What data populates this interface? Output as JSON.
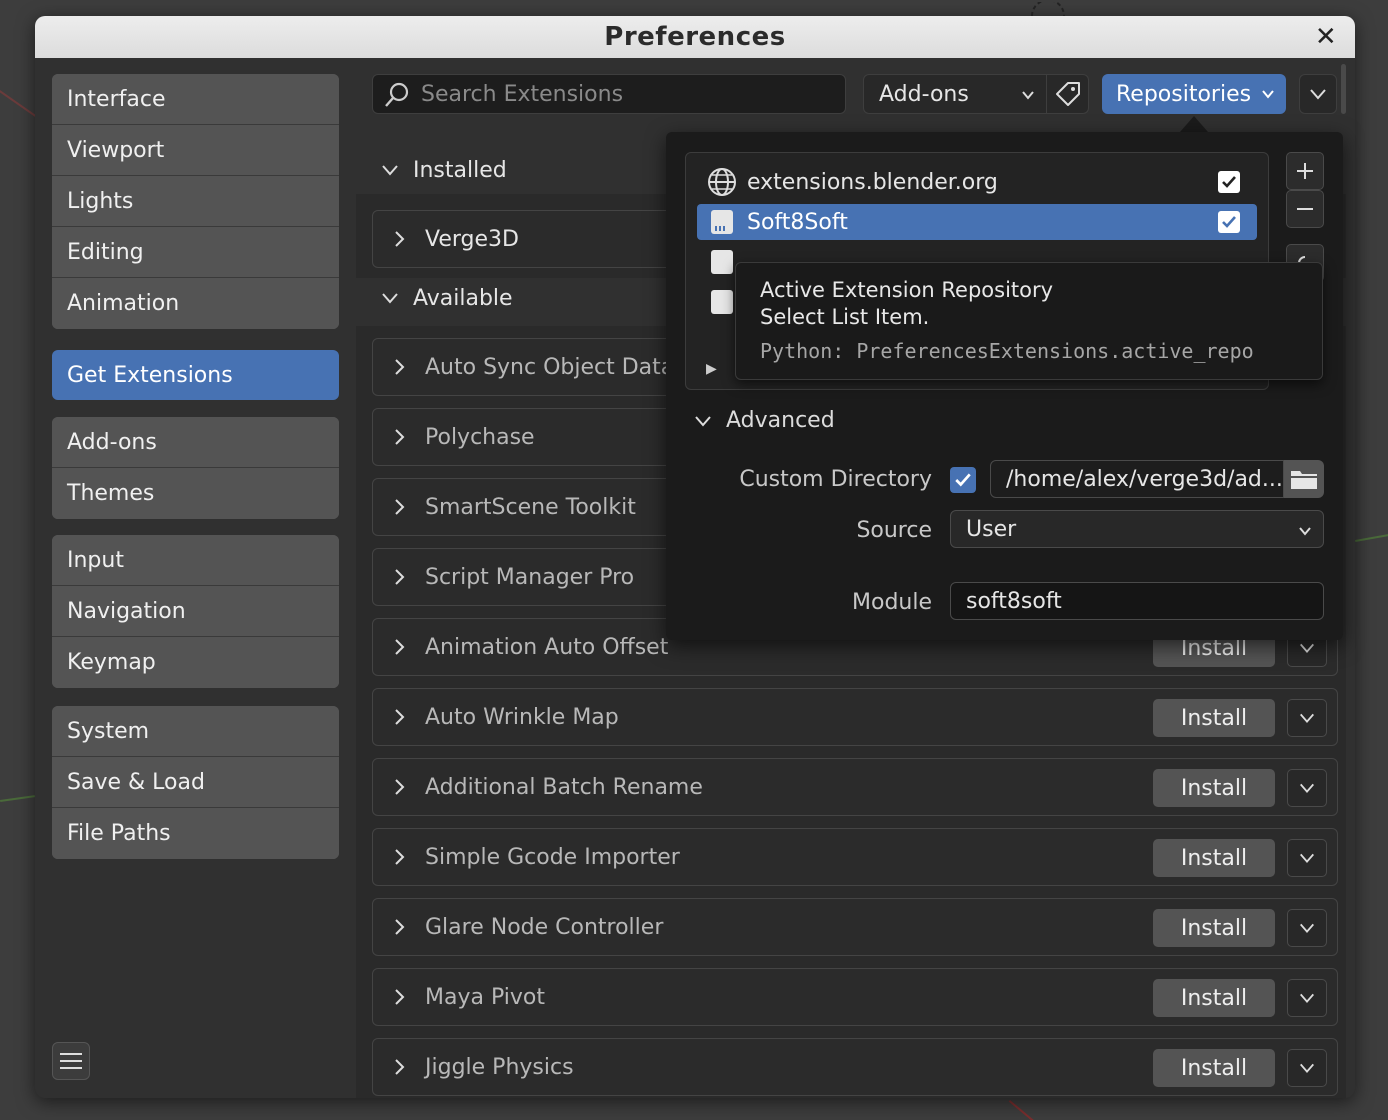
{
  "window": {
    "title": "Preferences"
  },
  "sidebar": {
    "groups": [
      [
        "Interface",
        "Viewport",
        "Lights",
        "Editing",
        "Animation"
      ],
      [
        "Get Extensions"
      ],
      [
        "Add-ons",
        "Themes"
      ],
      [
        "Input",
        "Navigation",
        "Keymap"
      ],
      [
        "System",
        "Save & Load",
        "File Paths"
      ]
    ],
    "active": "Get Extensions"
  },
  "toolbar": {
    "search_placeholder": "Search Extensions",
    "filter_selected": "Add-ons",
    "repositories_label": "Repositories"
  },
  "sections": {
    "installed": "Installed",
    "available": "Available"
  },
  "installed_items": [
    "Verge3D"
  ],
  "available_items": [
    "Auto Sync Object Data N",
    "Polychase",
    "SmartScene Toolkit",
    "Script Manager Pro",
    "Animation Auto Offset",
    "Auto Wrinkle Map",
    "Additional Batch Rename",
    "Simple Gcode Importer",
    "Glare Node Controller",
    "Maya Pivot",
    "Jiggle Physics"
  ],
  "install_label": "Install",
  "repositories": {
    "items": [
      {
        "name": "extensions.blender.org",
        "enabled": true
      },
      {
        "name": "Soft8Soft",
        "enabled": true,
        "selected": true
      }
    ],
    "advanced_label": "Advanced",
    "custom_directory_label": "Custom Directory",
    "custom_directory_checked": true,
    "custom_directory_value": "/home/alex/verge3d/ad...",
    "source_label": "Source",
    "source_value": "User",
    "module_label": "Module",
    "module_value": "soft8soft"
  },
  "tooltip": {
    "line1": "Active Extension Repository",
    "line2": "Select List Item.",
    "python": "Python: PreferencesExtensions.active_repo"
  },
  "colors": {
    "accent": "#4772b3",
    "window_bg": "#303030",
    "nav_item": "#545454"
  }
}
